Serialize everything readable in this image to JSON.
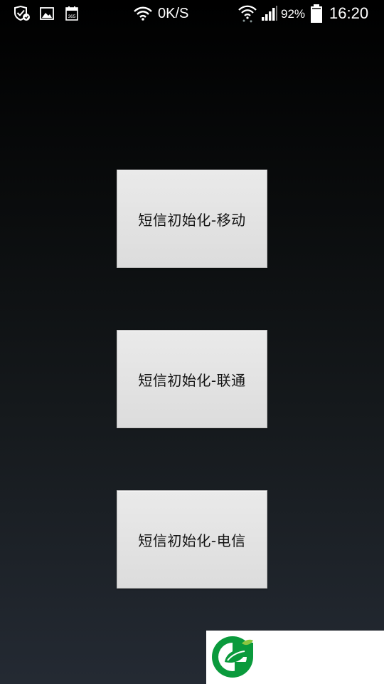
{
  "status_bar": {
    "network_speed": "0K/S",
    "battery_percent": "92%",
    "time": "16:20",
    "calendar_badge": "365",
    "icons": [
      "shield-check-icon",
      "gallery-icon",
      "calendar-365-icon",
      "wifi-icon",
      "wifi-signal-icon",
      "cellular-signal-icon",
      "battery-icon"
    ]
  },
  "buttons": [
    {
      "label": "短信初始化-移动"
    },
    {
      "label": "短信初始化-联通"
    },
    {
      "label": "短信初始化-电信"
    }
  ],
  "colors": {
    "button_bg": "#dfdfdf",
    "logo_green": "#0a9a3c",
    "logo_light_green": "#8cc63f"
  }
}
